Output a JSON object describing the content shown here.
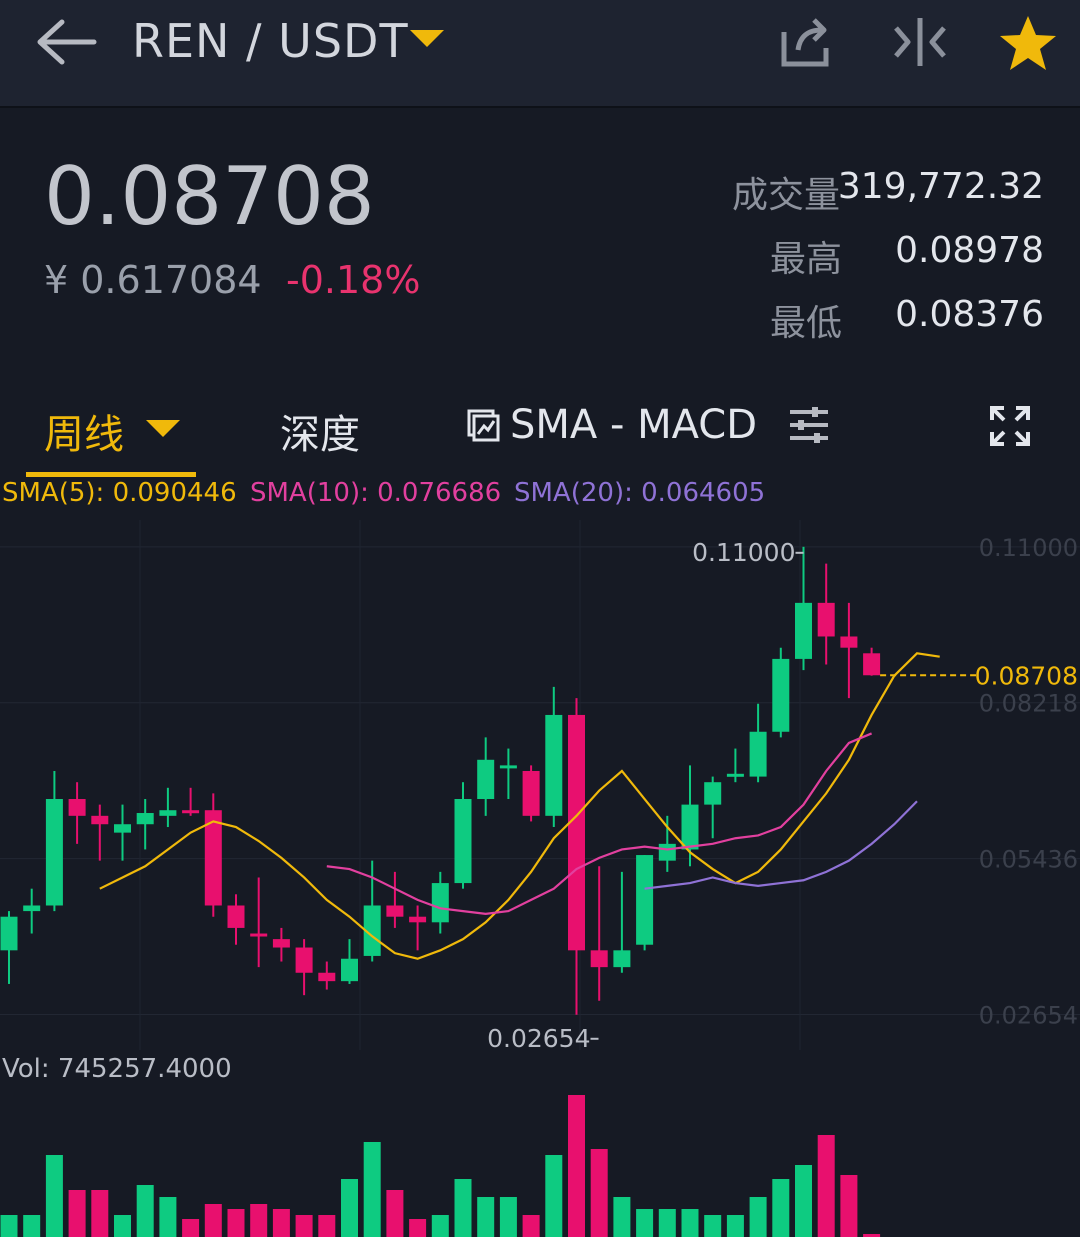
{
  "header": {
    "pair": "REN / USDT"
  },
  "ticker": {
    "last_price": "0.08708",
    "cny_price": "¥ 0.617084",
    "change_pct": "-0.18%",
    "stats": [
      {
        "label": "成交量",
        "value": "319,772.32"
      },
      {
        "label": "最高",
        "value": "0.08978"
      },
      {
        "label": "最低",
        "value": "0.08376"
      }
    ]
  },
  "tabs": {
    "period": "周线",
    "depth": "深度",
    "indicator": "SMA - MACD"
  },
  "legend": {
    "sma5": "SMA(5): 0.090446",
    "sma10": "SMA(10): 0.076686",
    "sma20": "SMA(20): 0.064605"
  },
  "volume_label": "Vol: 745257.4000",
  "colors": {
    "up": "#0ecb81",
    "down": "#e8106e",
    "accent": "#f0b90b",
    "sma5": "#f0b90b",
    "sma10": "#e2409f",
    "sma20": "#8f72d6"
  },
  "icons": [
    "back-arrow-icon",
    "caret-down-icon",
    "share-icon",
    "compare-icon",
    "star-icon",
    "indicator-icon",
    "settings-sliders-icon",
    "fullscreen-icon"
  ],
  "chart_data": {
    "type": "candlestick",
    "y_axis_labels": [
      "0.11000",
      "0.08218",
      "0.05436",
      "0.02654"
    ],
    "ylim": [
      0.022,
      0.113
    ],
    "current_price_label": "0.08708",
    "high_marker": "0.11000",
    "low_marker": "0.02654",
    "candles": [
      {
        "o": 0.038,
        "h": 0.045,
        "l": 0.032,
        "c": 0.044
      },
      {
        "o": 0.045,
        "h": 0.049,
        "l": 0.041,
        "c": 0.046
      },
      {
        "o": 0.046,
        "h": 0.07,
        "l": 0.045,
        "c": 0.065
      },
      {
        "o": 0.065,
        "h": 0.068,
        "l": 0.057,
        "c": 0.062
      },
      {
        "o": 0.062,
        "h": 0.064,
        "l": 0.054,
        "c": 0.0605
      },
      {
        "o": 0.059,
        "h": 0.064,
        "l": 0.054,
        "c": 0.0605
      },
      {
        "o": 0.0605,
        "h": 0.065,
        "l": 0.056,
        "c": 0.0625
      },
      {
        "o": 0.062,
        "h": 0.067,
        "l": 0.06,
        "c": 0.063
      },
      {
        "o": 0.063,
        "h": 0.067,
        "l": 0.062,
        "c": 0.0625
      },
      {
        "o": 0.063,
        "h": 0.066,
        "l": 0.044,
        "c": 0.046
      },
      {
        "o": 0.046,
        "h": 0.048,
        "l": 0.039,
        "c": 0.042
      },
      {
        "o": 0.041,
        "h": 0.051,
        "l": 0.035,
        "c": 0.0405
      },
      {
        "o": 0.04,
        "h": 0.042,
        "l": 0.036,
        "c": 0.0385
      },
      {
        "o": 0.0385,
        "h": 0.04,
        "l": 0.03,
        "c": 0.034
      },
      {
        "o": 0.034,
        "h": 0.036,
        "l": 0.031,
        "c": 0.0325
      },
      {
        "o": 0.0325,
        "h": 0.04,
        "l": 0.032,
        "c": 0.0365
      },
      {
        "o": 0.037,
        "h": 0.054,
        "l": 0.036,
        "c": 0.046
      },
      {
        "o": 0.046,
        "h": 0.052,
        "l": 0.042,
        "c": 0.044
      },
      {
        "o": 0.044,
        "h": 0.046,
        "l": 0.038,
        "c": 0.043
      },
      {
        "o": 0.043,
        "h": 0.052,
        "l": 0.041,
        "c": 0.05
      },
      {
        "o": 0.05,
        "h": 0.068,
        "l": 0.049,
        "c": 0.065
      },
      {
        "o": 0.065,
        "h": 0.076,
        "l": 0.062,
        "c": 0.072
      },
      {
        "o": 0.071,
        "h": 0.074,
        "l": 0.065,
        "c": 0.071
      },
      {
        "o": 0.07,
        "h": 0.071,
        "l": 0.061,
        "c": 0.062
      },
      {
        "o": 0.062,
        "h": 0.085,
        "l": 0.06,
        "c": 0.08
      },
      {
        "o": 0.08,
        "h": 0.083,
        "l": 0.0265,
        "c": 0.038
      },
      {
        "o": 0.038,
        "h": 0.053,
        "l": 0.029,
        "c": 0.035
      },
      {
        "o": 0.035,
        "h": 0.052,
        "l": 0.034,
        "c": 0.038
      },
      {
        "o": 0.039,
        "h": 0.055,
        "l": 0.038,
        "c": 0.055
      },
      {
        "o": 0.054,
        "h": 0.062,
        "l": 0.052,
        "c": 0.057
      },
      {
        "o": 0.056,
        "h": 0.071,
        "l": 0.053,
        "c": 0.064
      },
      {
        "o": 0.064,
        "h": 0.069,
        "l": 0.058,
        "c": 0.068
      },
      {
        "o": 0.069,
        "h": 0.074,
        "l": 0.068,
        "c": 0.0695
      },
      {
        "o": 0.069,
        "h": 0.082,
        "l": 0.068,
        "c": 0.077
      },
      {
        "o": 0.077,
        "h": 0.092,
        "l": 0.076,
        "c": 0.09
      },
      {
        "o": 0.09,
        "h": 0.11,
        "l": 0.088,
        "c": 0.1
      },
      {
        "o": 0.1,
        "h": 0.107,
        "l": 0.089,
        "c": 0.094
      },
      {
        "o": 0.094,
        "h": 0.1,
        "l": 0.083,
        "c": 0.092
      },
      {
        "o": 0.091,
        "h": 0.092,
        "l": 0.087,
        "c": 0.08708
      }
    ],
    "volumes": [
      22,
      22,
      82,
      47,
      47,
      22,
      52,
      40,
      18,
      33,
      28,
      33,
      28,
      22,
      22,
      58,
      95,
      47,
      18,
      22,
      58,
      40,
      40,
      22,
      82,
      142,
      88,
      40,
      28,
      28,
      28,
      22,
      22,
      40,
      58,
      72,
      102,
      62,
      3
    ],
    "sma5": [
      0.049,
      0.051,
      0.053,
      0.056,
      0.059,
      0.061,
      0.06,
      0.0575,
      0.0545,
      0.051,
      0.047,
      0.044,
      0.0405,
      0.0375,
      0.0365,
      0.038,
      0.04,
      0.043,
      0.047,
      0.052,
      0.058,
      0.062,
      0.0665,
      0.07,
      0.065,
      0.06,
      0.0555,
      0.0525,
      0.05,
      0.052,
      0.056,
      0.061,
      0.066,
      0.072,
      0.08,
      0.087,
      0.091,
      0.0904
    ],
    "sma10": [
      null,
      null,
      null,
      null,
      null,
      null,
      null,
      null,
      null,
      0.053,
      0.0525,
      0.051,
      0.049,
      0.047,
      0.0455,
      0.045,
      0.0445,
      0.045,
      0.047,
      0.049,
      0.0525,
      0.0545,
      0.056,
      0.0565,
      0.056,
      0.0565,
      0.057,
      0.058,
      0.0585,
      0.06,
      0.064,
      0.07,
      0.075,
      0.0767
    ],
    "sma20": [
      null,
      null,
      null,
      null,
      null,
      null,
      null,
      null,
      null,
      null,
      null,
      null,
      null,
      null,
      null,
      null,
      null,
      null,
      null,
      0.049,
      0.0495,
      0.05,
      0.051,
      0.05,
      0.0495,
      0.05,
      0.0505,
      0.052,
      0.054,
      0.057,
      0.0605,
      0.0646
    ]
  }
}
